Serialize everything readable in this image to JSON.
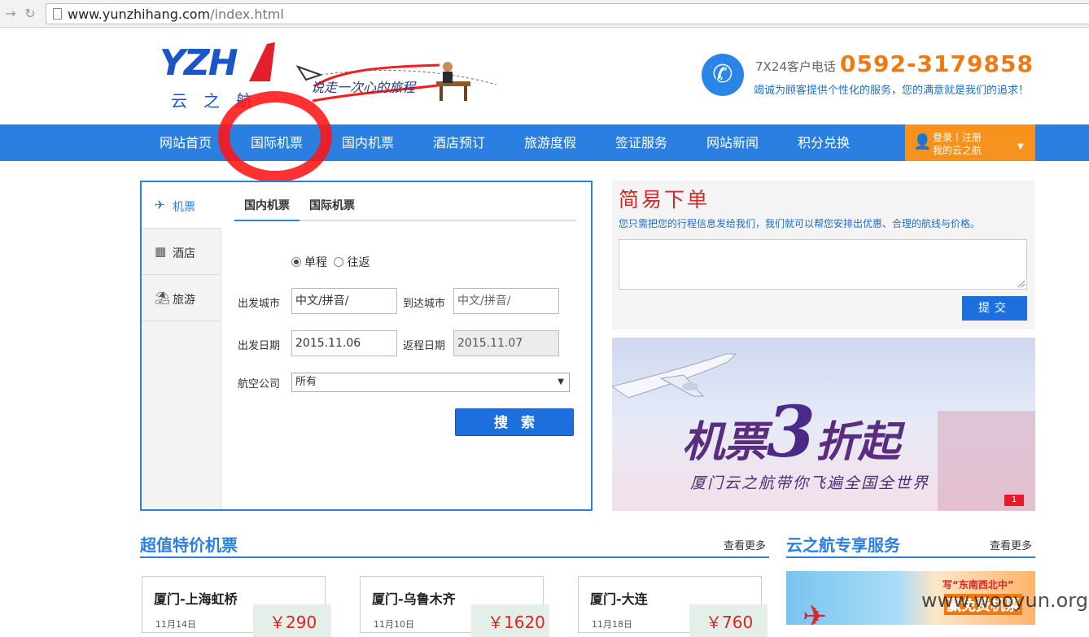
{
  "browser": {
    "url_host": "www.yunzhihang.com",
    "url_path": "/index.html"
  },
  "header": {
    "logo_letters": "YZH",
    "logo_sub": "云之航",
    "slogan": "说走一次心的旅程",
    "hotline_label": "7X24客户电话",
    "hotline_number": "0592-3179858",
    "hotline_desc": "竭诚为顾客提供个性化的服务，您的满意就是我们的追求！"
  },
  "nav": {
    "items": [
      "网站首页",
      "国际机票",
      "国内机票",
      "酒店预订",
      "旅游度假",
      "签证服务",
      "网站新闻",
      "积分兑换"
    ],
    "user_line1": "登录丨注册",
    "user_line2": "我的云之航"
  },
  "search": {
    "side_tabs": [
      "机票",
      "酒店",
      "旅游"
    ],
    "ticket_tabs": [
      "国内机票",
      "国际机票"
    ],
    "trip_one_way": "单程",
    "trip_round": "往返",
    "depart_city_label": "出发城市",
    "depart_city_placeholder": "中文/拼音/",
    "arrive_city_label": "到达城市",
    "arrive_city_placeholder": "中文/拼音/",
    "depart_date_label": "出发日期",
    "depart_date_value": "2015.11.06",
    "return_date_label": "返程日期",
    "return_date_value": "2015.11.07",
    "airline_label": "航空公司",
    "airline_selected": "所有",
    "search_button": "搜索"
  },
  "easy_order": {
    "title": "简易下单",
    "description": "您只需把您的行程信息发给我们，我们就可以帮您安排出优惠、合理的航线与价格。",
    "submit": "提交"
  },
  "banner": {
    "title_pre": "机票",
    "title_big": "3",
    "title_post": "折起",
    "subtitle": "厦门云之航带你飞遍全国全世界",
    "page_indicator": "1"
  },
  "sections": {
    "deals_title": "超值特价机票",
    "deals_more": "查看更多",
    "service_title": "云之航专享服务",
    "service_more": "查看更多"
  },
  "deals": [
    {
      "route": "厦门-上海虹桥",
      "date": "11月14日",
      "price": "￥290"
    },
    {
      "route": "厦门-乌鲁木齐",
      "date": "11月10日",
      "price": "￥1620"
    },
    {
      "route": "厦门-大连",
      "date": "11月18日",
      "price": "￥760"
    }
  ],
  "service_promo": {
    "line1": "写“东南西北中”",
    "line2": "赢免费机票"
  },
  "watermark": "www.wooyun.org",
  "colors": {
    "nav_blue": "#2b7fe0",
    "accent_orange": "#f7921e",
    "hotline_orange": "#f07a12",
    "annotation_red": "#ff1414"
  }
}
